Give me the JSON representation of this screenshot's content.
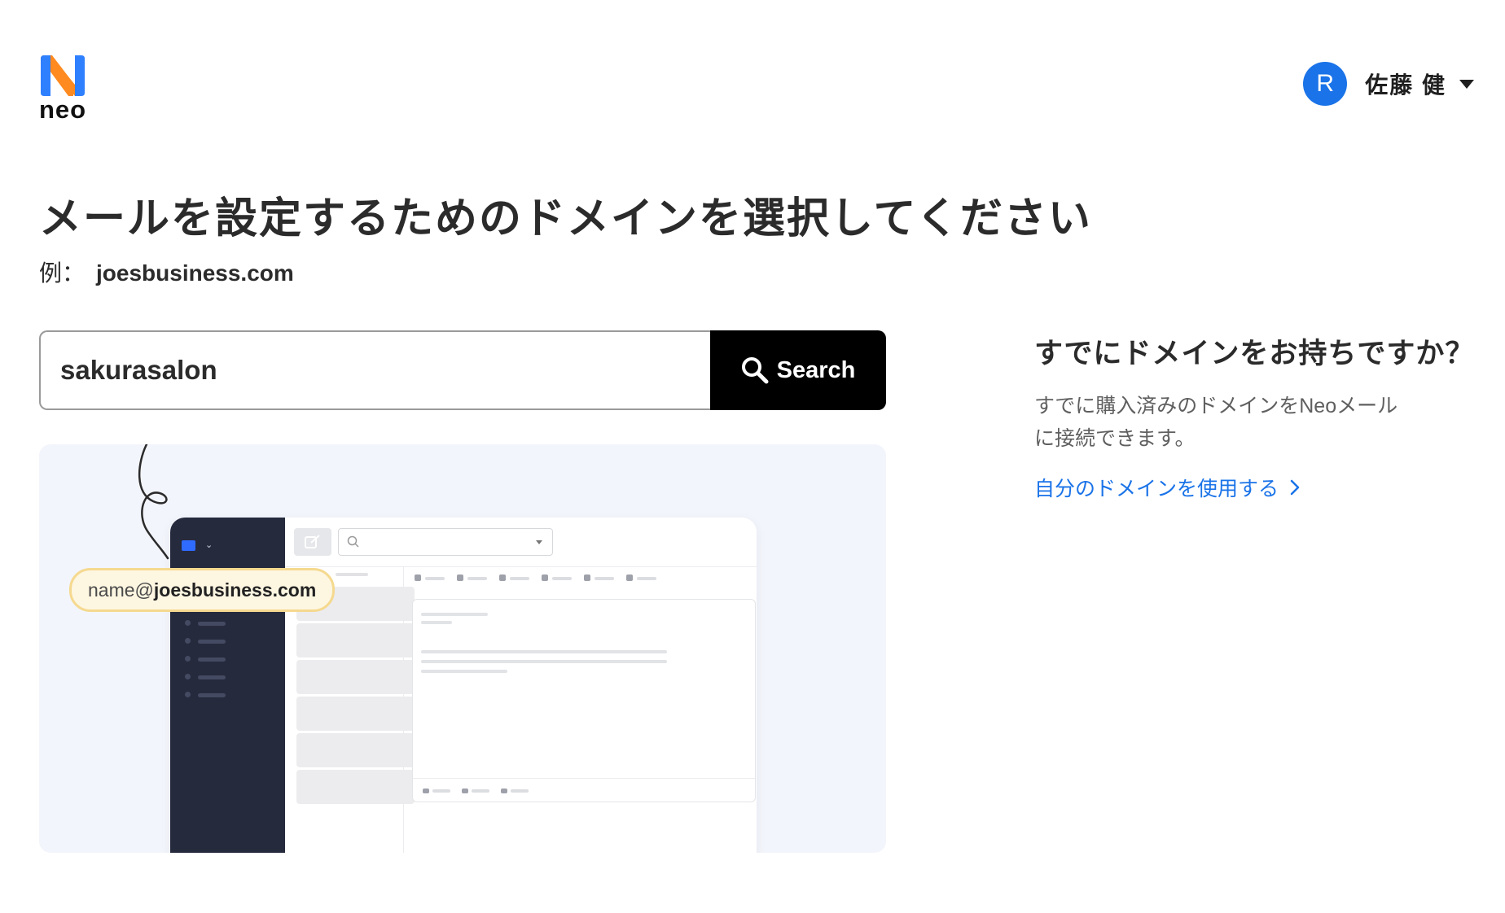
{
  "brand": {
    "name": "neo"
  },
  "user": {
    "initial": "R",
    "name": "佐藤 健"
  },
  "page": {
    "title": "メールを設定するためのドメインを選択してください",
    "example_prefix": "例：",
    "example_domain": "joesbusiness.com"
  },
  "search": {
    "value": "sakurasalon",
    "button_label": "Search"
  },
  "illustration": {
    "email_user": "name@",
    "email_domain": "joesbusiness.com"
  },
  "existing_domain": {
    "title": "すでにドメインをお持ちですか？",
    "description": "すでに購入済みのドメインをNeoメールに接続できます。",
    "link_label": "自分のドメインを使用する"
  },
  "colors": {
    "accent": "#1a73e8",
    "logo_blue": "#2f80ff",
    "logo_orange": "#ff8a1f",
    "illustration_bg": "#f3f5fc",
    "sidebar_dark": "#262a3d",
    "pill_bg": "#fdf6e1",
    "pill_border": "#f5d98f"
  },
  "icons": {
    "logo": "neo-logo-icon",
    "search": "search-icon",
    "caret": "caret-down-icon",
    "chevron": "chevron-right-icon"
  }
}
